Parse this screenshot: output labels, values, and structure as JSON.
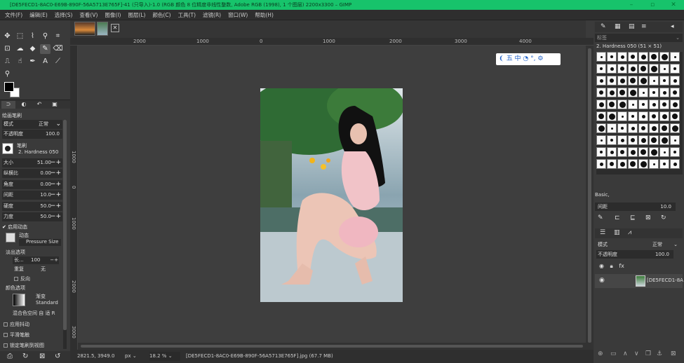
{
  "window": {
    "title": "[DE5FECD1-8AC0-E69B-890F-56A5713E765F]-41 (只导入)-1.0 (RGB 颜色 8 位精度非线性整数, Adobe RGB (1998), 1 个图层) 2200x3300 – GIMP"
  },
  "menubar": [
    "文件(F)",
    "编辑(E)",
    "选择(S)",
    "查看(V)",
    "图像(I)",
    "图层(L)",
    "颜色(C)",
    "工具(T)",
    "滤镜(R)",
    "窗口(W)",
    "帮助(H)"
  ],
  "toolbox": {
    "tabs": [
      "tool-options",
      "device-status",
      "undo-history",
      "images"
    ],
    "section_title": "绘画笔刷",
    "mode_label": "模式",
    "mode_value": "正常",
    "opacity_label": "不透明度",
    "opacity_value": "100.0",
    "brush_label": "笔刷",
    "brush_name": "2. Hardness 050",
    "options": [
      {
        "label": "大小",
        "value": "51.00"
      },
      {
        "label": "纵横比",
        "value": "0.00"
      },
      {
        "label": "角度",
        "value": "0.00"
      },
      {
        "label": "间距",
        "value": "10.0"
      },
      {
        "label": "硬度",
        "value": "50.0"
      },
      {
        "label": "力度",
        "value": "50.0"
      }
    ],
    "dynamics_label": "启用动态",
    "dynamics_sub": "动态",
    "dynamics_name": "Pressure Size",
    "fade_label": "淡出选项",
    "fade_length_label": "长...",
    "fade_length_value": "100",
    "fade_repeat_label": "重复",
    "fade_repeat_value": "无",
    "fade_reverse": "反向",
    "color_label": "颜色选项",
    "gradient_label": "渐变",
    "gradient_name": "Standard",
    "blend_label": "混合色空间 自 适 R",
    "jitter_label": "应用抖动",
    "smooth_label": "平滑笔触",
    "lock_label": "锁定笔刷到视图"
  },
  "rulers": {
    "top": [
      "2000",
      "1000",
      "0",
      "1000",
      "2000",
      "3000",
      "4000"
    ],
    "left": [
      "1000",
      "0",
      "1000",
      "2000",
      "3000"
    ]
  },
  "ime_toolbar": {
    "text": "五 中 ◔ °, ⚙"
  },
  "statusbar": {
    "coords": "2821.5, 3949.0",
    "unit": "px",
    "zoom": "18.2 %",
    "file_info": "[DE5FECD1-8AC0-E69B-890F-56A5713E765F].jpg (67.7 MB)"
  },
  "brushes_panel": {
    "filter": "标签",
    "selected": "2. Hardness 050 (51 × 51)",
    "preset": "Basic,",
    "spacing_label": "间距",
    "spacing_value": "10.0"
  },
  "layers_panel": {
    "mode_label": "模式",
    "mode_value": "正常",
    "opacity_label": "不透明度",
    "opacity_value": "100.0",
    "layer_name": "[DE5FECD1-8A"
  },
  "colors": {
    "accent": "#17c36b",
    "panel": "#3a3a3a",
    "canvas": "#3e3e3e"
  }
}
